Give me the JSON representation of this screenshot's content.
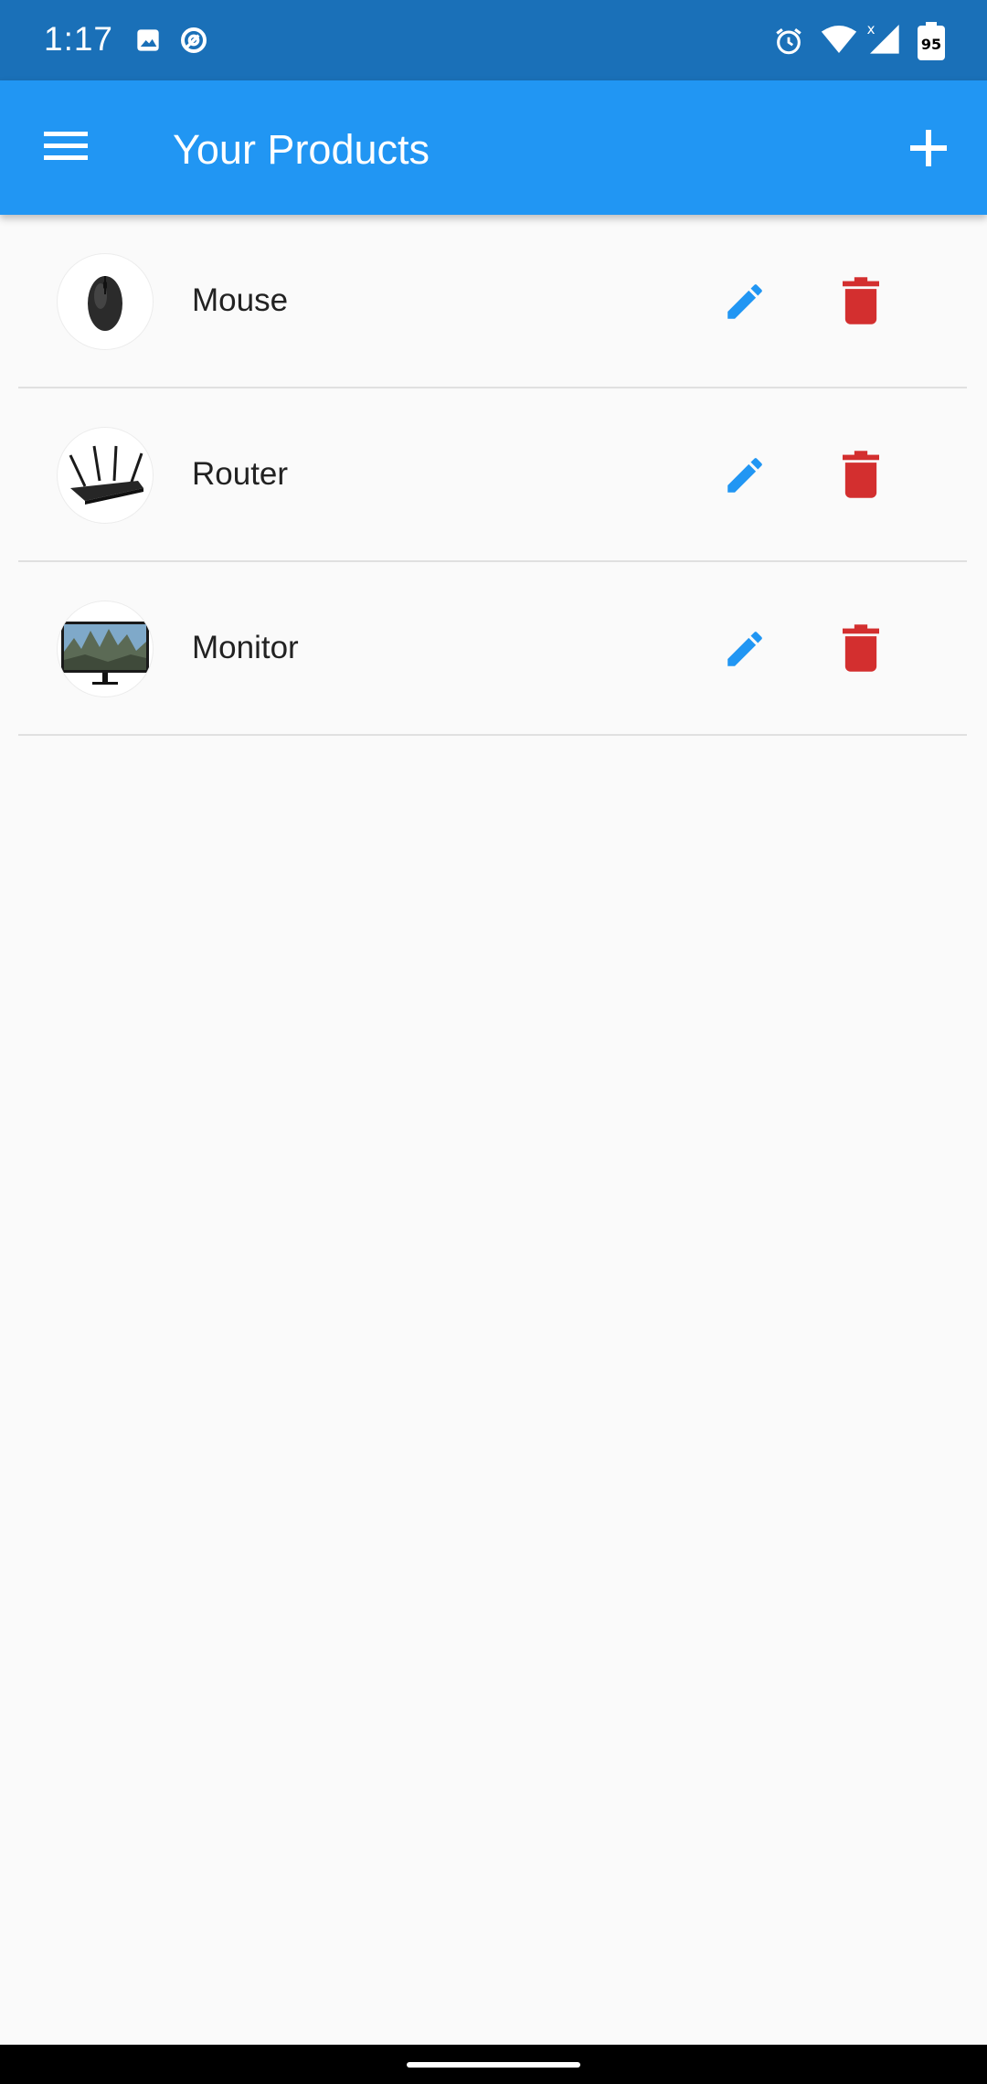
{
  "status_bar": {
    "time": "1:17",
    "left_icons": [
      "image-icon",
      "data-saver-icon"
    ],
    "right_icons": [
      "alarm-icon",
      "wifi-icon",
      "cell-signal-icon",
      "battery-icon"
    ],
    "battery_level": "95",
    "background_color": "#1a70b8"
  },
  "app_bar": {
    "title": "Your Products",
    "menu_icon": "hamburger-menu-icon",
    "action_icon": "add-icon",
    "background_color": "#2196f3"
  },
  "products": [
    {
      "name": "Mouse",
      "image": "mouse-image"
    },
    {
      "name": "Router",
      "image": "router-image"
    },
    {
      "name": "Monitor",
      "image": "monitor-image"
    }
  ],
  "row_actions": {
    "edit_icon": "pencil-icon",
    "delete_icon": "trash-icon",
    "edit_color": "#2196f3",
    "delete_color": "#d32f2f"
  }
}
